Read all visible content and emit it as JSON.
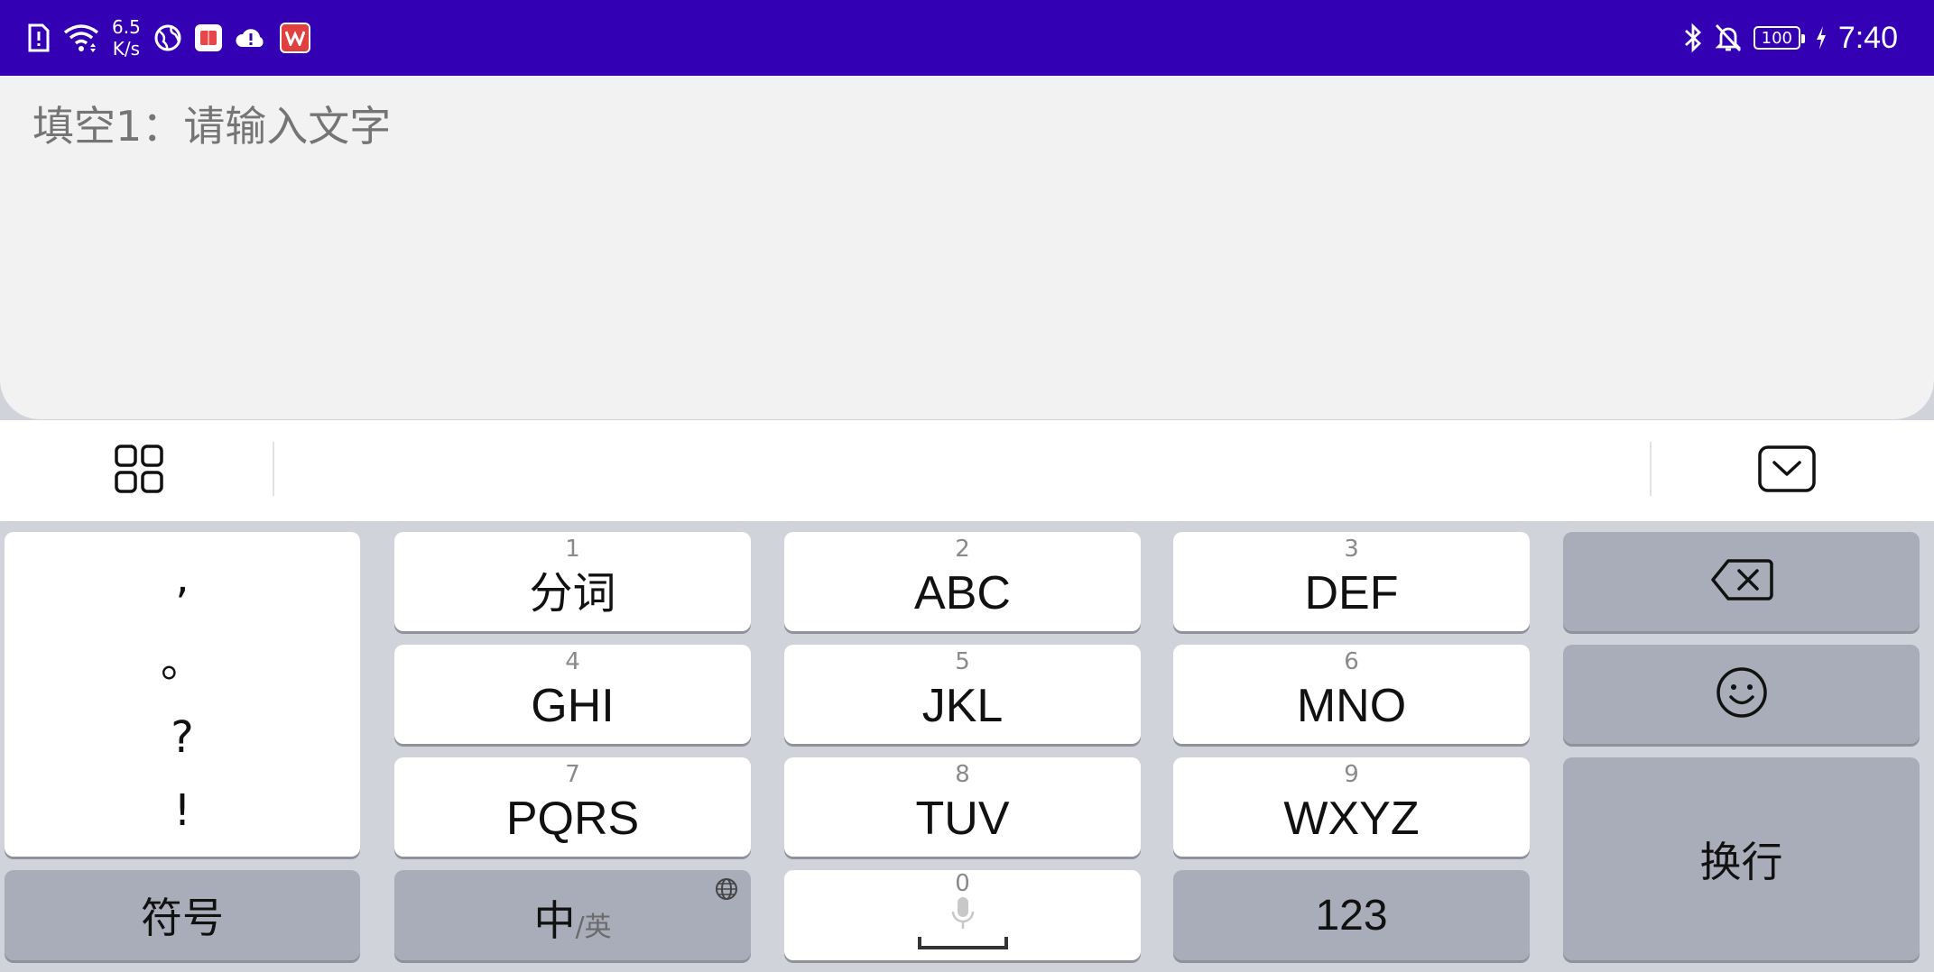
{
  "status_bar": {
    "speed_value": "6.5",
    "speed_unit": "K/s",
    "battery": "100",
    "time": "7:40",
    "left_icons": [
      "alert-sim-icon",
      "wifi-icon",
      "globe-icon",
      "book-app-icon",
      "cloud-alert-icon",
      "wps-app-icon"
    ],
    "right_icons": [
      "bluetooth-icon",
      "bell-muted-icon",
      "battery-icon",
      "charging-icon"
    ],
    "background": "#3300b4"
  },
  "text_field": {
    "placeholder": "填空1：请输入文字"
  },
  "toolbar": {
    "left_icon": "grid-menu-icon",
    "right_icon": "keyboard-hide-icon"
  },
  "keyboard": {
    "punctuation": [
      ",",
      "。",
      "?",
      "!"
    ],
    "keys": [
      {
        "num": "1",
        "label": "分词"
      },
      {
        "num": "2",
        "label": "ABC"
      },
      {
        "num": "3",
        "label": "DEF"
      },
      {
        "num": "4",
        "label": "GHI"
      },
      {
        "num": "5",
        "label": "JKL"
      },
      {
        "num": "6",
        "label": "MNO"
      },
      {
        "num": "7",
        "label": "PQRS"
      },
      {
        "num": "8",
        "label": "TUV"
      },
      {
        "num": "9",
        "label": "WXYZ"
      }
    ],
    "symbol_key": "符号",
    "lang_key_main": "中",
    "lang_key_sub": "/英",
    "space_num": "0",
    "num_key": "123",
    "enter_key": "换行",
    "backspace_icon": "backspace-icon",
    "emoji_icon": "emoji-icon"
  }
}
